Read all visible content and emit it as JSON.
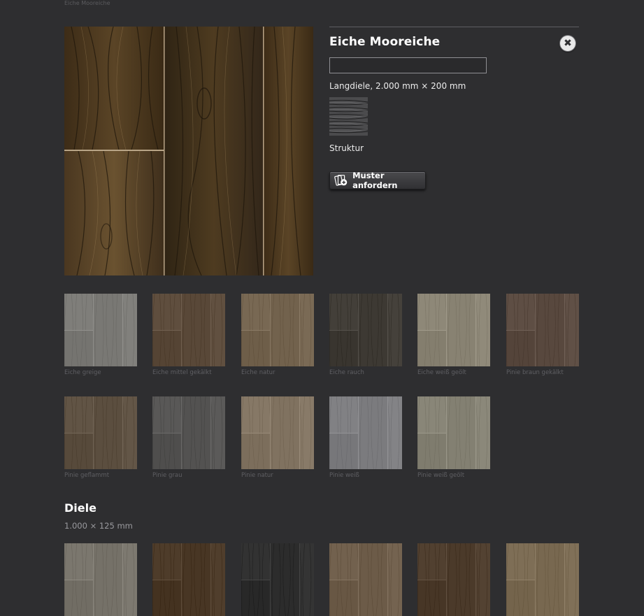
{
  "top_caption": "Eiche Mooreiche",
  "detail": {
    "title": "Eiche Mooreiche",
    "close_icon": "close-x-icon",
    "dimensions": "Langdiele, 2.000 mm × 200 mm",
    "structure_label": "Struktur",
    "sample_button": "Muster anfordern",
    "sample_icon": "add-sample-icon",
    "image_color": "#4b3a22"
  },
  "swatches_row1": [
    {
      "label": "Eiche greige",
      "color": "#7b7a76"
    },
    {
      "label": "Eiche mittel gekälkt",
      "color": "#5b4a3a"
    },
    {
      "label": "Eiche natur",
      "color": "#74644f"
    },
    {
      "label": "Eiche rauch",
      "color": "#3f3b35"
    },
    {
      "label": "Eiche weiß geölt",
      "color": "#8a8474"
    },
    {
      "label": "Pinie braun gekälkt",
      "color": "#5a4a40"
    }
  ],
  "swatches_row2": [
    {
      "label": "Pinie geflammt",
      "color": "#5d5041"
    },
    {
      "label": "Pinie grau",
      "color": "#555453"
    },
    {
      "label": "Pinie natur",
      "color": "#827462"
    },
    {
      "label": "Pinie weiß",
      "color": "#7d7d80"
    },
    {
      "label": "Pinie weiß geölt",
      "color": "#858274"
    }
  ],
  "section": {
    "title": "Diele",
    "subtitle": "1.000 × 125 mm"
  },
  "swatches_row3": [
    {
      "color": "#77736a"
    },
    {
      "color": "#4a3826"
    },
    {
      "color": "#2e2e2e"
    },
    {
      "color": "#6e5d4a"
    },
    {
      "color": "#4d3c2c"
    },
    {
      "color": "#7a6a52"
    }
  ]
}
